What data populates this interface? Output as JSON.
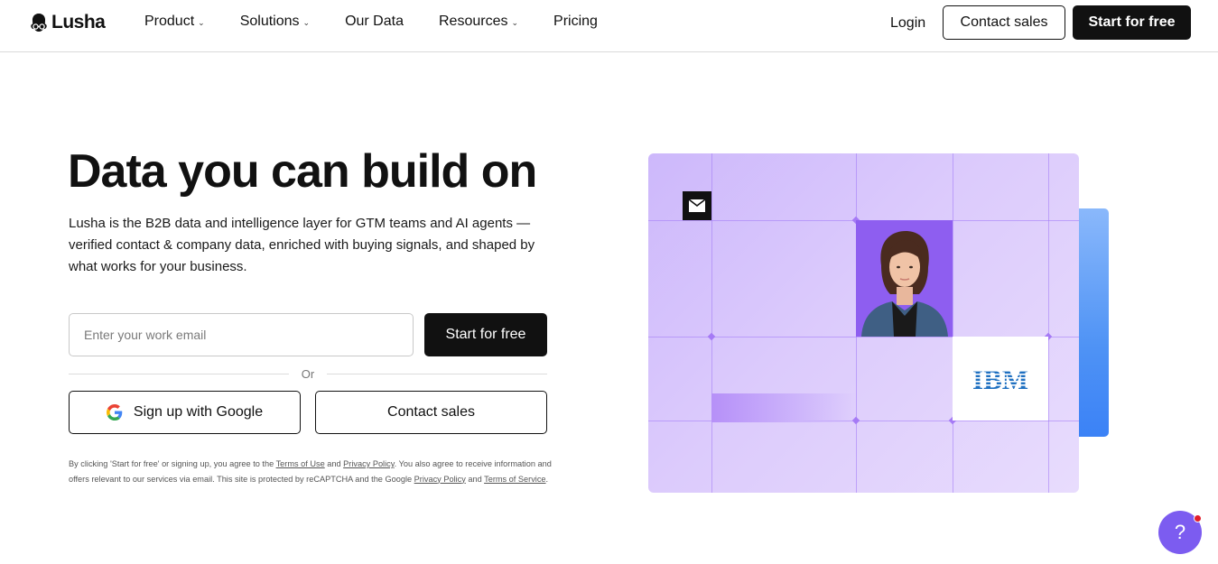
{
  "header": {
    "logo_text": "Lusha",
    "nav": [
      {
        "label": "Product",
        "has_dropdown": true
      },
      {
        "label": "Solutions",
        "has_dropdown": true
      },
      {
        "label": "Our Data",
        "has_dropdown": false
      },
      {
        "label": "Resources",
        "has_dropdown": true
      },
      {
        "label": "Pricing",
        "has_dropdown": false
      }
    ],
    "login_label": "Login",
    "contact_sales_label": "Contact sales",
    "start_free_label": "Start for free"
  },
  "hero": {
    "title": "Data you can build on",
    "subtitle": "Lusha is the B2B data and intelligence layer for GTM teams and AI agents — verified contact & company data, enriched with buying signals, and shaped by what works for your business.",
    "email_placeholder": "Enter your work email",
    "start_free_label": "Start for free",
    "or_label": "Or",
    "google_label": "Sign up with Google",
    "contact_sales_label": "Contact sales",
    "legal": {
      "part1": "By clicking 'Start for free' or signing up, you agree to the ",
      "terms_of_use": "Terms of Use",
      "part2": " and ",
      "privacy_policy": "Privacy Policy",
      "part3": ". You also agree to receive information and offers relevant to our services via email. This site is protected by reCAPTCHA and the Google ",
      "privacy_policy_google": "Privacy Policy",
      "part4": " and ",
      "terms_of_service": "Terms of Service",
      "part5": "."
    }
  },
  "visual": {
    "company_logo_text": "IBM",
    "icons": [
      "mail-icon",
      "portrait-photo",
      "ibm-logo"
    ]
  },
  "help": {
    "label": "?"
  },
  "colors": {
    "primary_dark": "#111111",
    "visual_purple": "#cdb8fb",
    "accent_blue": "#3b82f6",
    "help_purple": "#7c5cf0",
    "notification_red": "#e11d2a"
  }
}
